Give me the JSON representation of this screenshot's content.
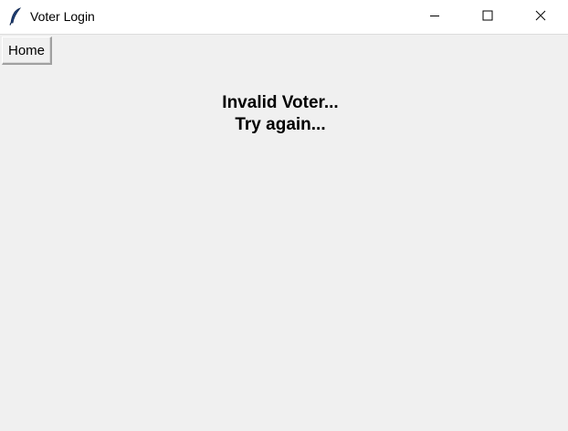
{
  "window": {
    "title": "Voter Login",
    "app_icon": "feather-icon",
    "controls": [
      "minimize-icon",
      "maximize-icon",
      "close-icon"
    ]
  },
  "toolbar": {
    "home_label": "Home"
  },
  "main": {
    "message_line1": "Invalid Voter...",
    "message_line2": "Try again..."
  },
  "colors": {
    "background": "#f0f0f0",
    "titlebar": "#ffffff",
    "text": "#000000"
  }
}
